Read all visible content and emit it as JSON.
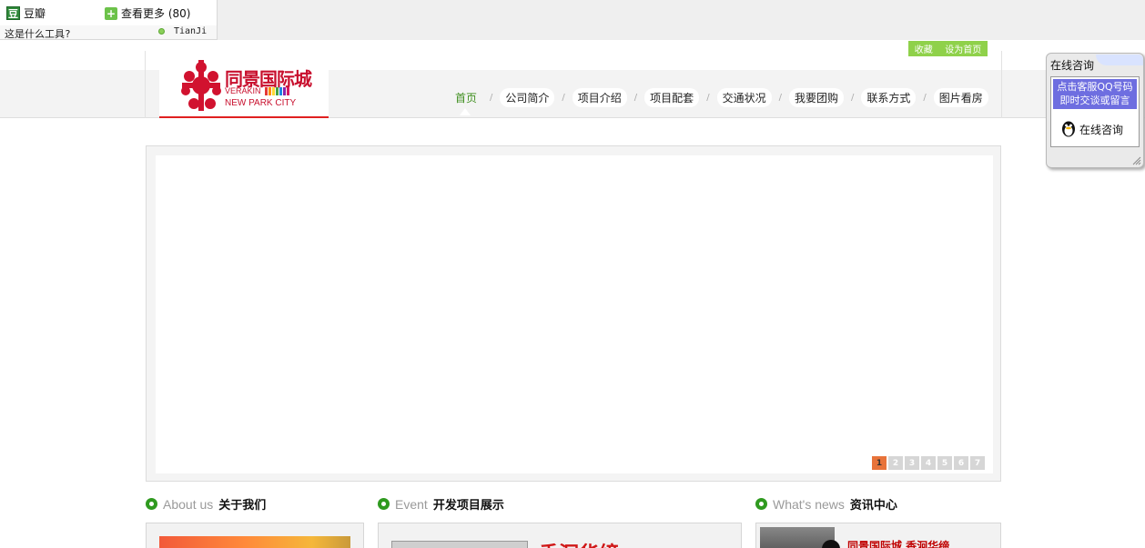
{
  "toolbox": {
    "douban_label": "豆瓣",
    "more_label": "查看更多 (80)",
    "whatis_label": "这是什么工具?",
    "tianji_label": "TianJi"
  },
  "topbar": {
    "favorite_label": "收藏",
    "set_home_label": "设为首页"
  },
  "logo": {
    "title": "同景国际城",
    "en_line1": "VERAKIN",
    "en_line2": "NEW PARK CITY",
    "stripe_colors": [
      "#e53935",
      "#fb8c00",
      "#fdd835",
      "#43a047",
      "#1e88e5",
      "#8e24aa",
      "#d81b60"
    ]
  },
  "nav": {
    "items": [
      {
        "label": "首页",
        "active": true
      },
      {
        "label": "公司简介"
      },
      {
        "label": "项目介绍"
      },
      {
        "label": "项目配套"
      },
      {
        "label": "交通状况"
      },
      {
        "label": "我要团购"
      },
      {
        "label": "联系方式"
      },
      {
        "label": "图片看房"
      }
    ]
  },
  "consult": {
    "title": "在线咨询",
    "note": "点击客服QQ号码即时交谈或留言",
    "qq_label": "在线咨询"
  },
  "banner": {
    "pages": [
      "1",
      "2",
      "3",
      "4",
      "5",
      "6",
      "7"
    ],
    "active_page": 1
  },
  "sections": {
    "about": {
      "en": "About us",
      "cn": "关于我们"
    },
    "event": {
      "en": "Event",
      "cn": "开发项目展示",
      "headline": "香洄华缔"
    },
    "news": {
      "en": "What's news",
      "cn": "资讯中心",
      "headline": "同景国际城 香洄华缔"
    }
  },
  "colors": {
    "brand_red": "#c8102e",
    "accent_green": "#2f9a1f",
    "consult_blue": "#6e6ee0",
    "pager_active": "#e8733a"
  }
}
